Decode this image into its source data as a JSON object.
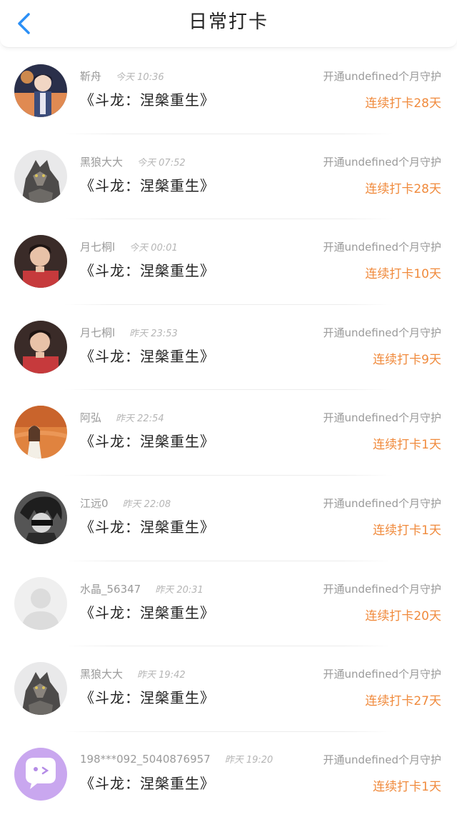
{
  "header": {
    "title": "日常打卡",
    "back_icon": "chevron-left-icon",
    "accent_color": "#2b8ff6"
  },
  "entries": [
    {
      "user": "靳舟",
      "time": "今天 10:36",
      "book": "《斗龙：涅槃重生》",
      "guard": "开通undefined个月守护",
      "streak": "连续打卡28天",
      "avatar": "anime-boy"
    },
    {
      "user": "黑狼大大",
      "time": "今天 07:52",
      "book": "《斗龙：涅槃重生》",
      "guard": "开通undefined个月守护",
      "streak": "连续打卡28天",
      "avatar": "wolf"
    },
    {
      "user": "月七桐l",
      "time": "今天 00:01",
      "book": "《斗龙：涅槃重生》",
      "guard": "开通undefined个月守护",
      "streak": "连续打卡10天",
      "avatar": "boy-red"
    },
    {
      "user": "月七桐l",
      "time": "昨天 23:53",
      "book": "《斗龙：涅槃重生》",
      "guard": "开通undefined个月守护",
      "streak": "连续打卡9天",
      "avatar": "boy-red"
    },
    {
      "user": "阿弘",
      "time": "昨天 22:54",
      "book": "《斗龙：涅槃重生》",
      "guard": "开通undefined个月守护",
      "streak": "连续打卡1天",
      "avatar": "orange-girl"
    },
    {
      "user": "江远0",
      "time": "昨天 22:08",
      "book": "《斗龙：涅槃重生》",
      "guard": "开通undefined个月守护",
      "streak": "连续打卡1天",
      "avatar": "manga-bw"
    },
    {
      "user": "水晶_56347",
      "time": "昨天 20:31",
      "book": "《斗龙：涅槃重生》",
      "guard": "开通undefined个月守护",
      "streak": "连续打卡20天",
      "avatar": "default-gray"
    },
    {
      "user": "黑狼大大",
      "time": "昨天 19:42",
      "book": "《斗龙：涅槃重生》",
      "guard": "开通undefined个月守护",
      "streak": "连续打卡27天",
      "avatar": "wolf"
    },
    {
      "user": "198***092_5040876957",
      "time": "昨天 19:20",
      "book": "《斗龙：涅槃重生》",
      "guard": "开通undefined个月守护",
      "streak": "连续打卡1天",
      "avatar": "purple-chat"
    }
  ],
  "colors": {
    "streak": "#f08a3c",
    "muted": "#9a9a9a",
    "text": "#222222"
  }
}
